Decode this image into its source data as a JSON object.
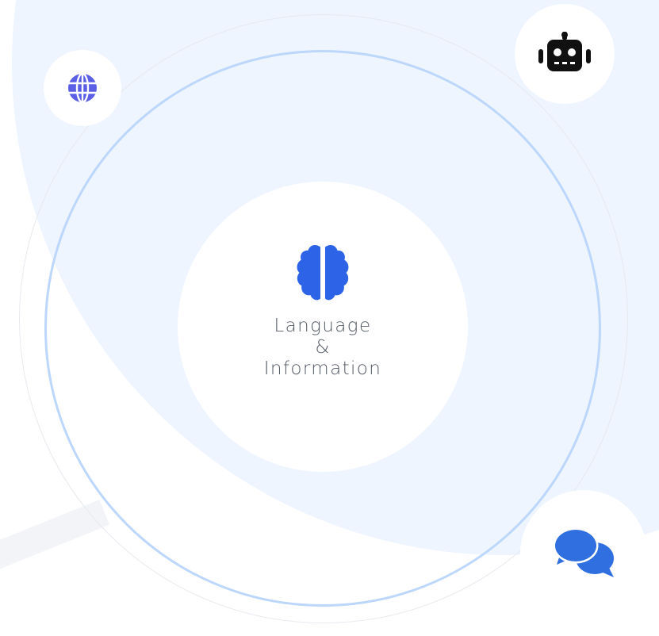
{
  "center": {
    "icon": "brain-icon",
    "label_line1": "Language",
    "label_line2": "&",
    "label_line3": "Information"
  },
  "orbit_icons": [
    {
      "name": "globe-icon",
      "color": "#5b5fe6"
    },
    {
      "name": "robot-icon",
      "color": "#111111"
    },
    {
      "name": "chat-icon",
      "color": "#2f6fe0"
    }
  ],
  "colors": {
    "background_blob": "#eef5ff",
    "main_ring": "#bcd7fb",
    "brain": "#2d63e6",
    "label_text": "#555b66"
  }
}
